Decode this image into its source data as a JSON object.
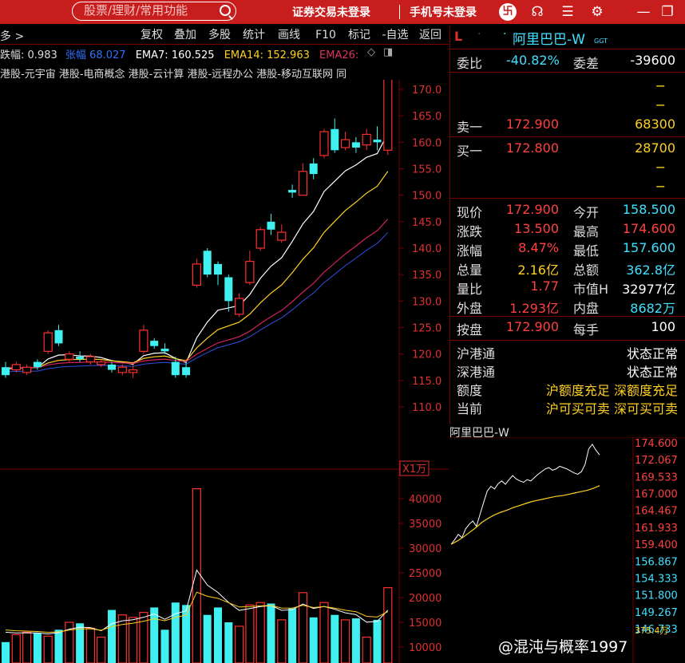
{
  "topbar": {
    "search_placeholder": "股票/理财/常用功能",
    "broker_login": "证券交易未登录",
    "phone_login": "手机号未登录"
  },
  "toolbar": {
    "more_label": "多 >",
    "buttons": [
      "复权",
      "叠加",
      "多股",
      "统计",
      "画线",
      "F10",
      "标记",
      "-自选",
      "返回"
    ]
  },
  "indicators": {
    "change_label": "跌幅:",
    "change_value": "0.983",
    "amp_label": "张幅",
    "amp_value": "68.027",
    "ema7_label": "EMA7:",
    "ema7_value": "160.525",
    "ema14_label": "EMA14:",
    "ema14_value": "152.963",
    "ema26_label": "EMA26:"
  },
  "concepts": "港股-元宇宙 港股-电商概念 港股-云计算 港股-远程办公 港股-移动互联网 同",
  "price_axis": [
    "170.0",
    "165.0",
    "160.0",
    "155.0",
    "150.0",
    "145.0",
    "140.0",
    "135.0",
    "130.0",
    "125.0",
    "120.0",
    "115.0",
    "110.0"
  ],
  "volume_axis": [
    "40000",
    "35000",
    "30000",
    "25000",
    "20000",
    "15000",
    "10000"
  ],
  "volume_unit": "X1万",
  "chart_data": {
    "type": "candlestick",
    "ema_series": [
      "EMA7",
      "EMA14",
      "EMA26"
    ],
    "ylim": [
      105,
      172
    ],
    "candles": [
      {
        "o": 117.5,
        "c": 116.0,
        "h": 118.5,
        "l": 115.5,
        "up": false
      },
      {
        "o": 117.0,
        "c": 118.0,
        "h": 118.5,
        "l": 116.5,
        "up": true
      },
      {
        "o": 116.5,
        "c": 117.5,
        "h": 118.0,
        "l": 116.0,
        "up": true
      },
      {
        "o": 118.5,
        "c": 117.5,
        "h": 119.0,
        "l": 117.0,
        "up": false
      },
      {
        "o": 120.5,
        "c": 124.0,
        "h": 124.5,
        "l": 120.0,
        "up": true
      },
      {
        "o": 124.5,
        "c": 122.0,
        "h": 125.5,
        "l": 121.5,
        "up": false
      },
      {
        "o": 119.0,
        "c": 120.0,
        "h": 120.5,
        "l": 118.5,
        "up": true
      },
      {
        "o": 119.5,
        "c": 119.0,
        "h": 120.5,
        "l": 118.5,
        "up": false
      },
      {
        "o": 118.5,
        "c": 119.5,
        "h": 120.0,
        "l": 118.0,
        "up": true
      },
      {
        "o": 118.0,
        "c": 118.5,
        "h": 119.0,
        "l": 117.5,
        "up": true
      },
      {
        "o": 118.0,
        "c": 117.0,
        "h": 118.5,
        "l": 116.5,
        "up": false
      },
      {
        "o": 116.5,
        "c": 117.5,
        "h": 118.0,
        "l": 116.0,
        "up": true
      },
      {
        "o": 116.5,
        "c": 117.0,
        "h": 118.0,
        "l": 115.5,
        "up": true
      },
      {
        "o": 120.5,
        "c": 124.5,
        "h": 125.5,
        "l": 120.0,
        "up": true
      },
      {
        "o": 122.5,
        "c": 121.5,
        "h": 123.0,
        "l": 121.0,
        "up": false
      },
      {
        "o": 121.0,
        "c": 120.5,
        "h": 122.0,
        "l": 120.0,
        "up": false
      },
      {
        "o": 118.5,
        "c": 116.0,
        "h": 119.5,
        "l": 115.5,
        "up": false
      },
      {
        "o": 117.5,
        "c": 116.0,
        "h": 118.5,
        "l": 115.5,
        "up": false
      },
      {
        "o": 133.0,
        "c": 137.0,
        "h": 138.0,
        "l": 132.5,
        "up": true
      },
      {
        "o": 139.5,
        "c": 135.0,
        "h": 140.0,
        "l": 134.5,
        "up": false
      },
      {
        "o": 137.0,
        "c": 135.0,
        "h": 137.5,
        "l": 133.0,
        "up": false
      },
      {
        "o": 134.5,
        "c": 130.0,
        "h": 135.0,
        "l": 128.0,
        "up": false
      },
      {
        "o": 127.5,
        "c": 130.5,
        "h": 131.5,
        "l": 127.0,
        "up": true
      },
      {
        "o": 133.5,
        "c": 137.5,
        "h": 139.5,
        "l": 133.0,
        "up": true
      },
      {
        "o": 140.0,
        "c": 143.5,
        "h": 144.0,
        "l": 139.5,
        "up": true
      },
      {
        "o": 145.0,
        "c": 143.5,
        "h": 146.5,
        "l": 142.5,
        "up": false
      },
      {
        "o": 141.5,
        "c": 143.0,
        "h": 144.5,
        "l": 141.0,
        "up": true
      },
      {
        "o": 151.0,
        "c": 150.5,
        "h": 152.0,
        "l": 149.5,
        "up": false
      },
      {
        "o": 150.0,
        "c": 154.5,
        "h": 156.0,
        "l": 150.0,
        "up": true
      },
      {
        "o": 156.0,
        "c": 154.0,
        "h": 157.0,
        "l": 153.0,
        "up": false
      },
      {
        "o": 157.5,
        "c": 162.0,
        "h": 162.5,
        "l": 157.0,
        "up": true
      },
      {
        "o": 162.5,
        "c": 158.5,
        "h": 164.5,
        "l": 158.0,
        "up": false
      },
      {
        "o": 159.0,
        "c": 160.5,
        "h": 162.0,
        "l": 158.5,
        "up": true
      },
      {
        "o": 160.0,
        "c": 159.0,
        "h": 161.0,
        "l": 158.0,
        "up": false
      },
      {
        "o": 159.5,
        "c": 161.5,
        "h": 162.5,
        "l": 158.5,
        "up": true
      },
      {
        "o": 160.5,
        "c": 160.0,
        "h": 163.0,
        "l": 158.5,
        "up": false
      },
      {
        "o": 158.5,
        "c": 172.9,
        "h": 174.6,
        "l": 157.6,
        "up": true
      }
    ],
    "volumes": [
      11000,
      12500,
      13000,
      12800,
      12200,
      13500,
      15000,
      14800,
      13800,
      12000,
      17500,
      16500,
      16000,
      17000,
      18000,
      13500,
      19000,
      18500,
      42000,
      16500,
      18000,
      15000,
      14200,
      18500,
      19000,
      18800,
      15500,
      17800,
      21000,
      16000,
      19000,
      16500,
      15500,
      15800,
      12000,
      15500,
      22000
    ]
  },
  "quote": {
    "flag": "L",
    "name": "阿里巴巴-W",
    "subscript": "GGT",
    "weibi_label": "委比",
    "weibi_value": "-40.82%",
    "weicha_label": "委差",
    "weicha_value": "-39600",
    "sell1_label": "卖一",
    "sell1_price": "172.900",
    "sell1_vol": "68300",
    "buy1_label": "买一",
    "buy1_price": "172.800",
    "buy1_vol": "28700",
    "dash": "−",
    "rows": [
      {
        "l1": "现价",
        "v1": "172.900",
        "l2": "今开",
        "v2": "158.500",
        "c2": "cyan"
      },
      {
        "l1": "涨跌",
        "v1": "13.500",
        "l2": "最高",
        "v2": "174.600",
        "c2": "red"
      },
      {
        "l1": "涨幅",
        "v1": "8.47%",
        "l2": "最低",
        "v2": "157.600",
        "c2": "cyan"
      },
      {
        "l1": "总量",
        "v1": "2.16亿",
        "l2": "总额",
        "v2": "362.8亿",
        "c1": "yellow",
        "c2": "cyan"
      },
      {
        "l1": "量比",
        "v1": "1.77",
        "l2": "市值H",
        "v2": "32977亿",
        "c2": "white"
      },
      {
        "l1": "外盘",
        "v1": "1.293亿",
        "l2": "内盘",
        "v2": "8682万",
        "c2": "cyan"
      }
    ],
    "anpan_label": "按盘",
    "anpan_value": "172.900",
    "meishou_label": "每手",
    "meishou_value": "100",
    "hkconnect": [
      {
        "label": "沪港通",
        "value": "状态正常"
      },
      {
        "label": "深港通",
        "value": "状态正常"
      },
      {
        "label": "额度",
        "value": "沪额度充足 深额度充足"
      },
      {
        "label": "当前",
        "value": "沪可买可卖 深可买可卖"
      }
    ]
  },
  "mini": {
    "title": "阿里巴巴-W",
    "axis": [
      "174.600",
      "172.067",
      "169.533",
      "167.000",
      "164.467",
      "161.933",
      "159.400",
      "156.867",
      "154.333",
      "151.800",
      "149.267",
      "146.733"
    ],
    "vol_label": "375.4万"
  },
  "watermark": "@混沌与概率1997",
  "colors": {
    "up": "#ff3030",
    "down": "#40f0f0",
    "ema7": "#ffffff",
    "ema14": "#ffd020",
    "ema26": "#d02060",
    "grid": "#7a0000"
  }
}
